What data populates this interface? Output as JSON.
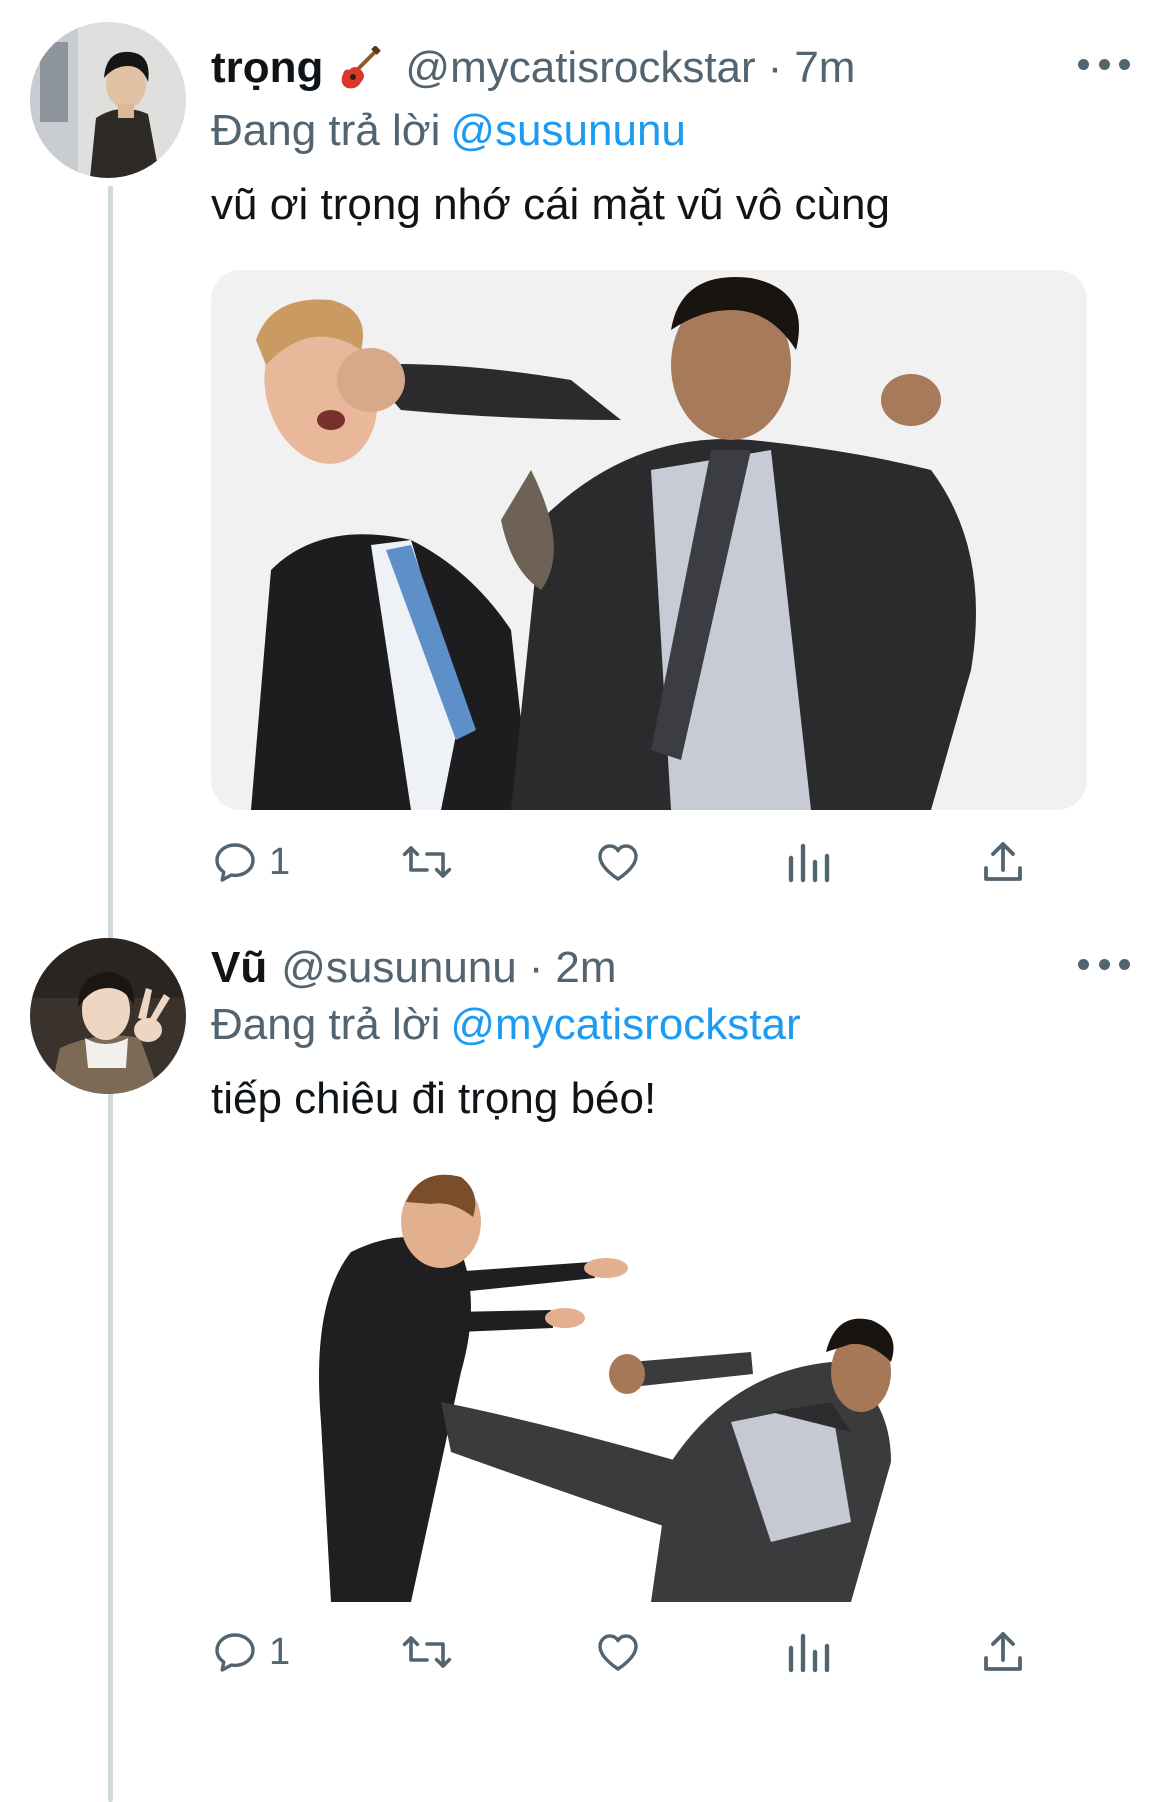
{
  "tweets": [
    {
      "name": "trọng",
      "emoji": "guitar-icon",
      "handle": "@mycatisrockstar",
      "separator": "·",
      "time": "7m",
      "reply_prefix": "Đang trả lời",
      "reply_to": "@susununu",
      "text": "vũ ơi trọng nhớ cái mặt vũ vô cùng",
      "reply_count": "1"
    },
    {
      "name": "Vũ",
      "handle": "@susununu",
      "separator": "·",
      "time": "2m",
      "reply_prefix": "Đang trả lời",
      "reply_to": "@mycatisrockstar",
      "text": "tiếp chiêu đi trọng béo!",
      "reply_count": "1"
    }
  ],
  "colors": {
    "link": "#1d9bf0",
    "secondary": "#536471",
    "text": "#0f1419",
    "thread_line": "#cfd9de"
  }
}
